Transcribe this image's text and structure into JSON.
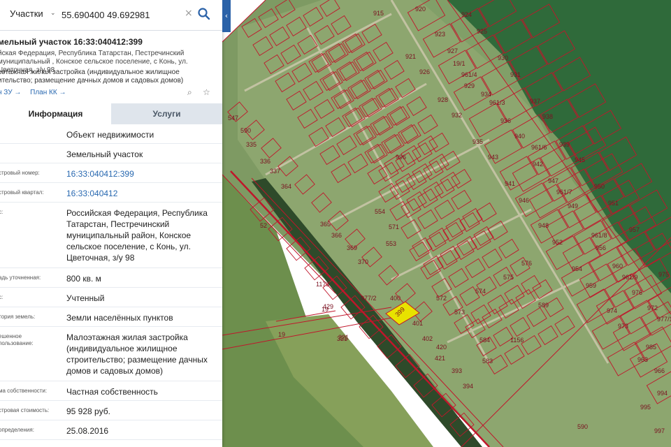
{
  "search": {
    "type_label": "Участки",
    "value": "55.690400 49.692981"
  },
  "object": {
    "title": "мельный участок 16:33:040412:399",
    "address": "йская Федерация, Республика Татарстан, Пестречинский муниципальный , Конское сельское поселение, с Конь, ул. Цветочная, з/у 98",
    "use": "оэтажная жилая застройка (индивидуальное жилищное ительство; размещение дачных домов и садовых домов)",
    "link_zu": "н ЗУ →",
    "link_kk": "План КК →"
  },
  "tabs": [
    {
      "label": "Информация"
    },
    {
      "label": "Услуги"
    }
  ],
  "rows": [
    {
      "label": "",
      "value": "Объект недвижимости"
    },
    {
      "label": "",
      "value": "Земельный участок"
    },
    {
      "label": "стровый номер:",
      "value": "16:33:040412:399"
    },
    {
      "label": "стровый квартал:",
      "value": "16:33:040412"
    },
    {
      "label": "с:",
      "value": "Российская Федерация, Республика Татарстан, Пестречинский муниципальный район, Конское сельское поселение, с Конь, ул. Цветочная, з/у 98"
    },
    {
      "label": "адь уточненная:",
      "value": "800 кв. м"
    },
    {
      "label": "с:",
      "value": "Учтенный"
    },
    {
      "label": "тория земель:",
      "value": "Земли населённых пунктов"
    },
    {
      "label": "ешенное\nпользование:",
      "value": "Малоэтажная жилая застройка (индивидуальное жилищное строительство; размещение дачных домов и садовых домов)"
    },
    {
      "label": "ма собственности:",
      "value": "Частная собственность"
    },
    {
      "label": "стровая стоимость:",
      "value": "95 928 руб."
    },
    {
      "label": "определения:",
      "value": "25.08.2016"
    }
  ],
  "map": {
    "highlight_color": "#e8e200",
    "boundary_color": "#c0162b",
    "labels": [
      "915",
      "920",
      "924",
      "925",
      "923",
      "921",
      "927",
      "930",
      "926",
      "931",
      "928",
      "929",
      "934",
      "937",
      "932",
      "936",
      "938",
      "935",
      "940",
      "939",
      "943",
      "945",
      "942",
      "950",
      "941",
      "947",
      "951",
      "946",
      "949",
      "957",
      "948",
      "952",
      "956",
      "954",
      "960",
      "959",
      "975",
      "976",
      "974",
      "972",
      "973",
      "985",
      "963",
      "966",
      "994",
      "995",
      "996",
      "997",
      "398",
      "399",
      "400",
      "401",
      "402",
      "420",
      "421",
      "393",
      "394",
      "370",
      "369",
      "366",
      "365",
      "364",
      "337",
      "336",
      "335",
      "590",
      "547",
      "553",
      "554",
      "571",
      "572",
      "573",
      "574",
      "575",
      "576",
      "584",
      "583",
      "1156",
      "589",
      "19",
      "321",
      "52",
      "1173",
      "429",
      "19/1",
      "961/4",
      "961/3",
      "961/6",
      "961/7",
      "961/8",
      "961/9",
      "977/1",
      "977/2",
      "252/1"
    ],
    "label_399": "399",
    "label_321": "321",
    "label_19": "19",
    "label_590": "590"
  }
}
